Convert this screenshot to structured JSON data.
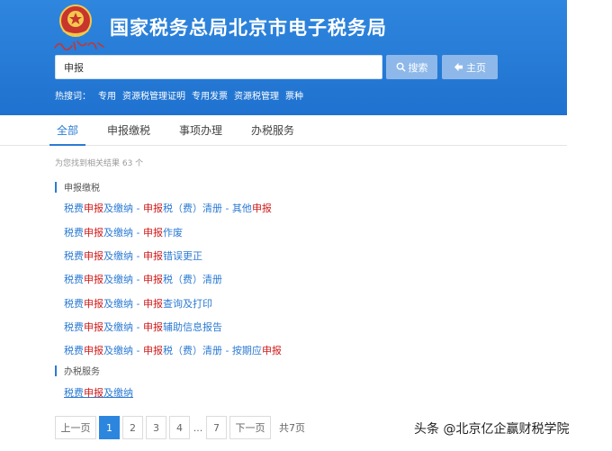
{
  "header": {
    "title": "国家税务总局北京市电子税务局",
    "brand_signature": "中国税务"
  },
  "search": {
    "value": "申报",
    "search_button": "搜索",
    "home_button": "主页"
  },
  "hotwords": {
    "label": "热搜词：",
    "items": [
      "专用",
      "资源税管理证明",
      "专用发票",
      "资源税管理",
      "票种"
    ]
  },
  "tabs": [
    {
      "label": "全部",
      "active": true
    },
    {
      "label": "申报缴税",
      "active": false
    },
    {
      "label": "事项办理",
      "active": false
    },
    {
      "label": "办税服务",
      "active": false
    }
  ],
  "result_count": "为您找到相关结果 63 个",
  "sections": [
    {
      "title": "申报缴税",
      "results": [
        [
          "税费",
          "申报",
          "及缴纳 - ",
          "申报",
          "税（费）清册 - 其他",
          "申报",
          ""
        ],
        [
          "税费",
          "申报",
          "及缴纳 - ",
          "申报",
          "作废"
        ],
        [
          "税费",
          "申报",
          "及缴纳 - ",
          "申报",
          "错误更正"
        ],
        [
          "税费",
          "申报",
          "及缴纳 - ",
          "申报",
          "税（费）清册"
        ],
        [
          "税费",
          "申报",
          "及缴纳 - ",
          "申报",
          "查询及打印"
        ],
        [
          "税费",
          "申报",
          "及缴纳 - ",
          "申报",
          "辅助信息报告"
        ],
        [
          "税费",
          "申报",
          "及缴纳 - ",
          "申报",
          "税（费）清册 - 按期应",
          "申报",
          ""
        ]
      ]
    },
    {
      "title": "办税服务",
      "results": [
        [
          "税费",
          "申报",
          "及缴纳"
        ]
      ]
    }
  ],
  "pagination": {
    "prev": "上一页",
    "pages": [
      "1",
      "2",
      "3",
      "4"
    ],
    "ellipsis": "...",
    "last_page": "7",
    "next": "下一页",
    "total": "共7页",
    "current": 1
  },
  "watermark": "头条 @北京亿企赢财税学院",
  "icons": {
    "search_button_icon": "search-icon",
    "home_button_icon": "back-arrow-icon",
    "logo": "tax-emblem-icon"
  },
  "colors": {
    "header_blue": "#2379d6",
    "link_blue": "#2c7bd3",
    "highlight_red": "#d01a1a",
    "active_page": "#2c86de"
  }
}
